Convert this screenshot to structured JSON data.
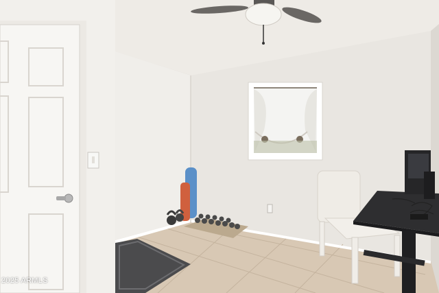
{
  "photo": {
    "subject": "",
    "watermark": "2025 ARMLS"
  }
}
